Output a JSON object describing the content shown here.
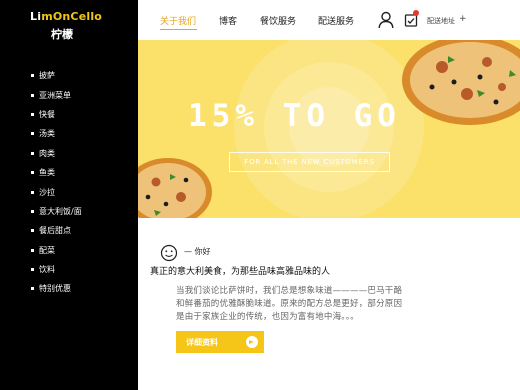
{
  "brand": {
    "logo_prefix": "Li",
    "logo_rest": "mOnCello",
    "name_cn": "柠檬"
  },
  "sidebar": {
    "items": [
      {
        "label": "披萨"
      },
      {
        "label": "亚洲菜单"
      },
      {
        "label": "快餐"
      },
      {
        "label": "汤类"
      },
      {
        "label": "肉类"
      },
      {
        "label": "鱼类"
      },
      {
        "label": "沙拉"
      },
      {
        "label": "意大利饭/面"
      },
      {
        "label": "餐后甜点"
      },
      {
        "label": "配菜"
      },
      {
        "label": "饮料"
      },
      {
        "label": "特别优惠"
      }
    ]
  },
  "nav": {
    "about": "关于我们",
    "blog": "博客",
    "catering": "餐饮服务",
    "delivery": "配送服务",
    "address": "配送地址",
    "address_plus": "+"
  },
  "banner": {
    "promo": "15% TO GO",
    "promo_sub": "FOR ALL THE NEW CUSTOMERS"
  },
  "content": {
    "greeting": "— 你好",
    "headline": "真正的意大利美食，为那些品味高雅品味的人",
    "paragraph_lines": [
      "当我们谈论比萨饼时，我们总是想象味道————巴马干酪",
      "和鲜番茄的优雅酥脆味道。原来的配方总是更好，部分原因",
      "是由于家族企业的传统，也因为富有地中海。。。"
    ],
    "button": "详细资料"
  },
  "colors": {
    "accent": "#e8a317",
    "banner_bg": "#fbe06a",
    "button_bg": "#f5c518",
    "sidebar_bg": "#000000",
    "badge": "#e23b2e"
  },
  "icons": {
    "user": "user-icon",
    "notification": "notification-icon",
    "smile": "smile-icon",
    "arrow": "arrow-right-icon"
  }
}
